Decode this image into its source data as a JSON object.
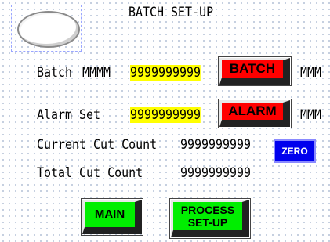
{
  "title": "BATCH SET-UP",
  "rows": {
    "batch": {
      "label": "Batch",
      "unit_prefix": "MMMM",
      "value": "9999999999",
      "button": "BATCH",
      "unit": "MMM"
    },
    "alarm": {
      "label": "Alarm Set",
      "value": "9999999999",
      "button": "ALARM",
      "unit": "MMM"
    },
    "current": {
      "label": "Current Cut Count",
      "value": "9999999999",
      "button": "ZERO"
    },
    "total": {
      "label": "Total Cut Count",
      "value": "9999999999"
    }
  },
  "nav": {
    "main": "MAIN",
    "process": "PROCESS SET-UP"
  },
  "colors": {
    "red": "#ff0000",
    "green": "#00ee00",
    "blue": "#0000ee",
    "yellow": "#ffff00"
  }
}
